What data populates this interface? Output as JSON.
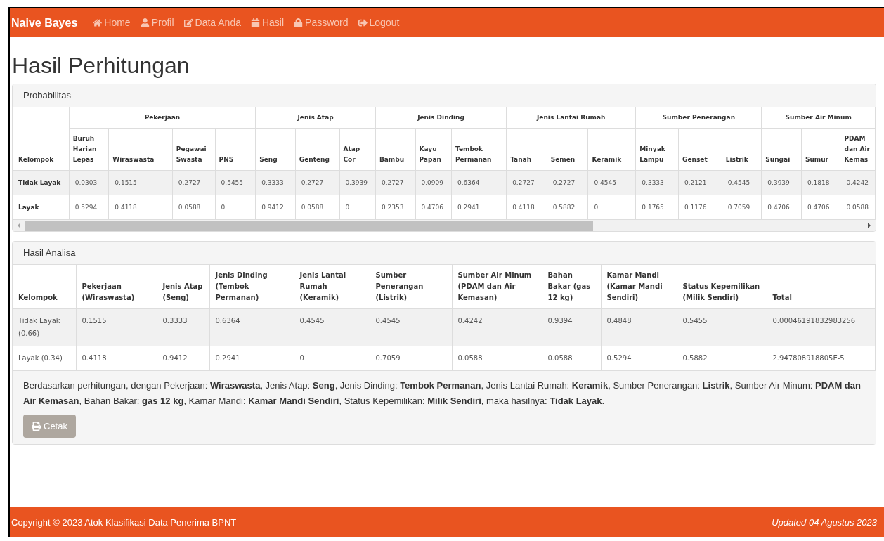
{
  "navbar": {
    "brand": "Naive Bayes",
    "items": [
      {
        "label": "Home"
      },
      {
        "label": "Profil"
      },
      {
        "label": "Data Anda"
      },
      {
        "label": "Hasil"
      },
      {
        "label": "Password"
      },
      {
        "label": "Logout"
      }
    ]
  },
  "title": "Hasil Perhitungan",
  "probabilitas": {
    "heading": "Probabilitas",
    "group_header": "Kelompok",
    "groups": [
      {
        "label": "Pekerjaan",
        "columns": [
          "Buruh Harian Lepas",
          "Wiraswasta",
          "Pegawai Swasta",
          "PNS"
        ]
      },
      {
        "label": "Jenis Atap",
        "columns": [
          "Seng",
          "Genteng",
          "Atap Cor"
        ]
      },
      {
        "label": "Jenis Dinding",
        "columns": [
          "Bambu",
          "Kayu Papan",
          "Tembok Permanan"
        ]
      },
      {
        "label": "Jenis Lantai Rumah",
        "columns": [
          "Tanah",
          "Semen",
          "Keramik"
        ]
      },
      {
        "label": "Sumber Penerangan",
        "columns": [
          "Minyak Lampu",
          "Genset",
          "Listrik"
        ]
      },
      {
        "label": "Sumber Air Minum",
        "columns": [
          "Sungai",
          "Sumur",
          "PDAM dan Air Kemas"
        ]
      }
    ],
    "rows": [
      {
        "kelompok": "Tidak Layak",
        "values": [
          "0.0303",
          "0.1515",
          "0.2727",
          "0.5455",
          "0.3333",
          "0.2727",
          "0.3939",
          "0.2727",
          "0.0909",
          "0.6364",
          "0.2727",
          "0.2727",
          "0.4545",
          "0.3333",
          "0.2121",
          "0.4545",
          "0.3939",
          "0.1818",
          "0.4242"
        ]
      },
      {
        "kelompok": "Layak",
        "values": [
          "0.5294",
          "0.4118",
          "0.0588",
          "0",
          "0.9412",
          "0.0588",
          "0",
          "0.2353",
          "0.4706",
          "0.2941",
          "0.4118",
          "0.5882",
          "0",
          "0.1765",
          "0.1176",
          "0.7059",
          "0.4706",
          "0.4706",
          "0.0588"
        ]
      }
    ]
  },
  "hasil_analisa": {
    "heading": "Hasil Analisa",
    "columns": [
      "Kelompok",
      "Pekerjaan (Wiraswasta)",
      "Jenis Atap (Seng)",
      "Jenis Dinding (Tembok Permanan)",
      "Jenis Lantai Rumah (Keramik)",
      "Sumber Penerangan (Listrik)",
      "Sumber Air Minum (PDAM dan Air Kemasan)",
      "Bahan Bakar (gas 12 kg)",
      "Kamar Mandi (Kamar Mandi Sendiri)",
      "Status Kepemilikan (Milik Sendiri)",
      "Total"
    ],
    "rows": [
      [
        "Tidak Layak (0.66)",
        "0.1515",
        "0.3333",
        "0.6364",
        "0.4545",
        "0.4545",
        "0.4242",
        "0.9394",
        "0.4848",
        "0.5455",
        "0.00046191832983256"
      ],
      [
        "Layak (0.34)",
        "0.4118",
        "0.9412",
        "0.2941",
        "0",
        "0.7059",
        "0.0588",
        "0.0588",
        "0.5294",
        "0.5882",
        "2.947808918805E-5"
      ]
    ],
    "conclusion": "Berdasarkan perhitungan, dengan Pekerjaan: **Wiraswasta**, Jenis Atap: **Seng**, Jenis Dinding: **Tembok Permanan**, Jenis Lantai Rumah: **Keramik**, Sumber Penerangan: **Listrik**, Sumber Air Minum: **PDAM dan Air Kemasan**, Bahan Bakar: **gas 12 kg**, Kamar Mandi: **Kamar Mandi Sendiri**, Status Kepemilikan: **Milik Sendiri**, maka hasilnya: **Tidak Layak**.",
    "print_button": "Cetak"
  },
  "footer": {
    "copyright": "Copyright © 2023 Atok Klasifikasi Data Penerima BPNT",
    "updated": "Updated 04 Agustus 2023"
  }
}
